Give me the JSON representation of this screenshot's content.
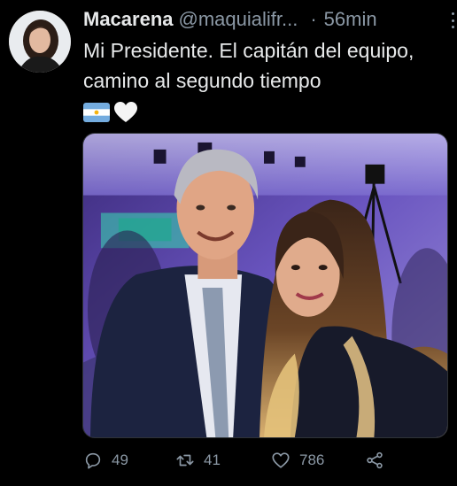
{
  "tweet": {
    "display_name": "Macarena",
    "handle": "@maquialifr...",
    "separator": "·",
    "time": "56min",
    "text": "Mi Presidente. El capitán del equipo, camino al segundo tiempo",
    "emojis": [
      "argentina-flag",
      "white-heart"
    ]
  },
  "actions": {
    "replies": "49",
    "retweets": "41",
    "likes": "786"
  },
  "colors": {
    "background": "#000000",
    "text": "#e7e9ea",
    "secondary": "#8b98a5",
    "border": "#2f3336"
  }
}
